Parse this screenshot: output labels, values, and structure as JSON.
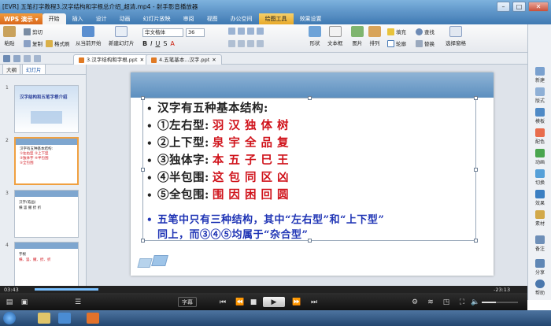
{
  "window": {
    "title": "[EVR] 五笔打字教程3.汉字结构和字根总介绍_超清.mp4 - 射手影音播放器",
    "min": "–",
    "max": "□",
    "close": "✕"
  },
  "menubar": {
    "app_button": "WPS 演示",
    "tabs": [
      {
        "label": "开始"
      },
      {
        "label": "插入"
      },
      {
        "label": "设计"
      },
      {
        "label": "动画"
      },
      {
        "label": "幻灯片放映"
      },
      {
        "label": "审阅"
      },
      {
        "label": "视图"
      },
      {
        "label": "办公空间"
      },
      {
        "label": "绘图工具"
      },
      {
        "label": "效果设置"
      }
    ]
  },
  "ribbon": {
    "paste": "粘贴",
    "cut": "剪切",
    "copy": "复制",
    "format_painter": "格式刷",
    "from_current": "从当前开始",
    "new_slide": "新建幻灯片",
    "font_name": "华文楷体",
    "font_size": "36",
    "shape": "形状",
    "textbox": "文本框",
    "picture": "图片",
    "arrange": "排列",
    "fill": "填充",
    "outline": "轮廓",
    "find": "查找",
    "replace": "替换",
    "select_pane": "选择窗格"
  },
  "doc_tabs": [
    {
      "label": "3.汉字结构和字根.ppt"
    },
    {
      "label": "4.五笔基本...汉字.ppt"
    }
  ],
  "left_pane": {
    "tabs": [
      "大纲",
      "幻灯片"
    ],
    "slide_numbers": [
      "1",
      "2",
      "3",
      "4",
      "5"
    ],
    "thumb1_title": "汉字结构和五笔字根介绍",
    "thumb2_lines": [
      "汉字有五种基本结构:",
      "①左右型 ②上下型",
      "③独体字 ④半包围",
      "⑤全包围"
    ],
    "thumb3_lines": [
      "汉字(笔画)",
      "横 竖 撇 捺 折"
    ],
    "thumb4_lines": [
      "字根",
      "横、竖、撇、捺、折"
    ]
  },
  "slide": {
    "heading": "汉字有五种基本结构:",
    "items": [
      {
        "label": "①左右型:",
        "examples": "羽 汉 独 体 树"
      },
      {
        "label": "②上下型:",
        "examples": "泉 宇 全 品 复"
      },
      {
        "label": "③独体字:",
        "examples": "本 五 子 巳 王"
      },
      {
        "label": "④半包围:",
        "examples": "这 包 同 区 凶"
      },
      {
        "label": "⑤全包围:",
        "examples": "围 因 困 回 圆"
      }
    ],
    "note_line1": "五笔中只有三种结构，其中“左右型”和“上下型”",
    "note_line2": "同上，而③④⑤均属于“杂合型”"
  },
  "right_sidebar": {
    "items": [
      "新建",
      "版式",
      "模板",
      "配色",
      "动画",
      "切换",
      "效果",
      "素材",
      "备注",
      "分享",
      "帮助"
    ]
  },
  "player": {
    "elapsed": "03:43",
    "remaining": "-23:13",
    "progress": 0.14,
    "subtitle_button": "字幕",
    "volume": 0.4
  },
  "colors": {
    "accent_blue": "#3f79b2",
    "wps_orange": "#e07a24",
    "red_text": "#d0141c",
    "blue_text": "#1f34b5"
  }
}
